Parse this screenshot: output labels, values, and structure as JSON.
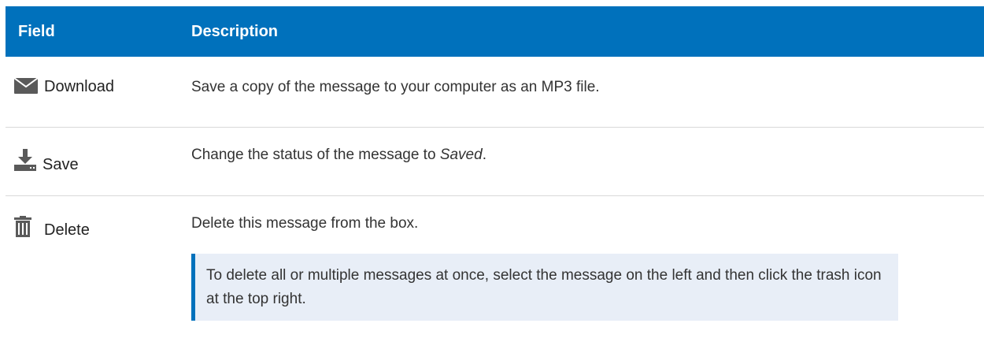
{
  "table": {
    "headers": {
      "field": "Field",
      "description": "Description"
    },
    "rows": [
      {
        "icon": "envelope-icon",
        "field": "Download",
        "description": "Save a copy of the message to your computer as an MP3 file."
      },
      {
        "icon": "download-save-icon",
        "field": "Save",
        "description_prefix": "Change the status of the message to ",
        "description_emphasis": "Saved",
        "description_suffix": "."
      },
      {
        "icon": "trash-icon",
        "field": "Delete",
        "description": "Delete this message from the box.",
        "note": "To delete all or multiple messages at once, select the message on the left and then click the trash icon at the top right."
      }
    ]
  },
  "colors": {
    "header_background": "#0071bc",
    "header_text": "#ffffff",
    "note_background": "#e8eef7",
    "note_border": "#0071bc",
    "icon_color": "#5a5a5a"
  }
}
